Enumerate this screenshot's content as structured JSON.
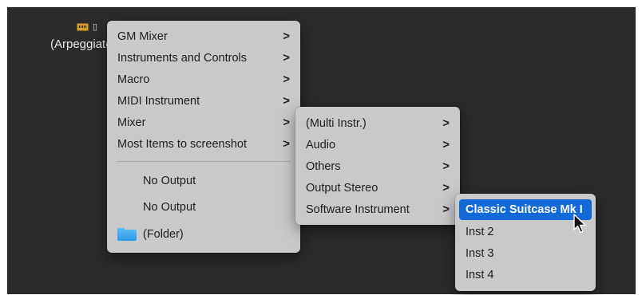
{
  "track": {
    "name": "(Arpeggiator)",
    "icon": "keyboard-icon"
  },
  "menu1": {
    "items": [
      {
        "label": "GM Mixer",
        "submenu": true
      },
      {
        "label": "Instruments and Controls",
        "submenu": true
      },
      {
        "label": "Macro",
        "submenu": true
      },
      {
        "label": "MIDI Instrument",
        "submenu": true
      },
      {
        "label": "Mixer",
        "submenu": true
      },
      {
        "label": "Most Items to screenshot",
        "submenu": true
      }
    ],
    "outputs": [
      {
        "label": "No Output"
      },
      {
        "label": "No Output"
      }
    ],
    "folder": {
      "label": "(Folder)",
      "icon": "folder-icon"
    }
  },
  "menu2": {
    "items": [
      {
        "label": "(Multi Instr.)",
        "submenu": true
      },
      {
        "label": "Audio",
        "submenu": true
      },
      {
        "label": "Others",
        "submenu": true
      },
      {
        "label": "Output Stereo",
        "submenu": true
      },
      {
        "label": "Software Instrument",
        "submenu": true
      }
    ]
  },
  "menu3": {
    "items": [
      {
        "label": "Classic Suitcase Mk I",
        "selected": true
      },
      {
        "label": "Inst 2"
      },
      {
        "label": "Inst 3"
      },
      {
        "label": "Inst 4"
      }
    ]
  },
  "glyphs": {
    "chevron": ">"
  },
  "colors": {
    "background": "#2b2b2b",
    "menu": "#c9c9c9",
    "highlight": "#1469d8"
  }
}
